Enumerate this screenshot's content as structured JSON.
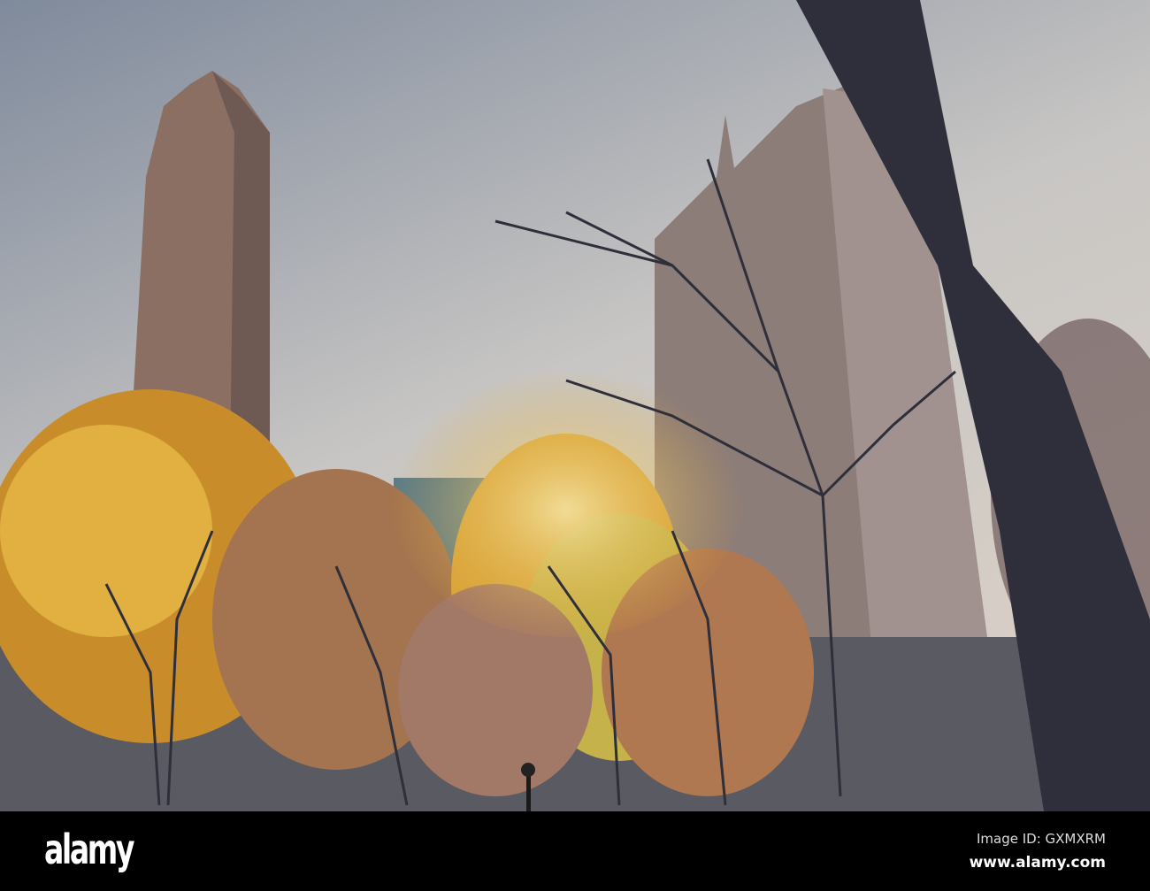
{
  "watermark": {
    "logo": "alamy",
    "image_id": "Image ID: GXMXRM",
    "site": "www.alamy.com"
  },
  "colors": {
    "sky_top": "#8a93a3",
    "sky_mid": "#c9c7c3",
    "foliage": "#e0a830",
    "trunk": "#2e2f3a"
  }
}
